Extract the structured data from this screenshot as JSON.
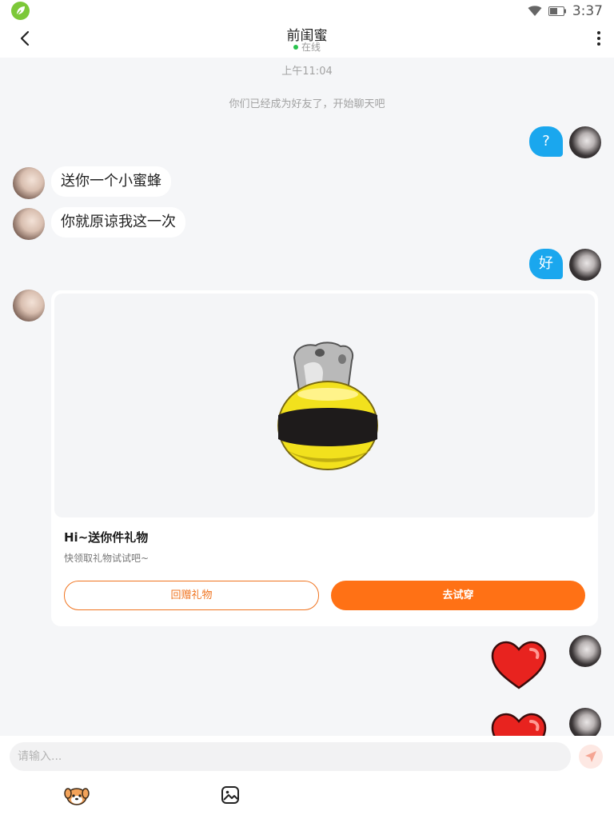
{
  "status_bar": {
    "time": "3:37",
    "icons": [
      "app-logo-icon",
      "wifi-icon",
      "battery-icon"
    ]
  },
  "header": {
    "title": "前闺蜜",
    "status": "在线",
    "icons": [
      "back-icon",
      "more-icon"
    ]
  },
  "timestamp": "上午11:04",
  "system_message": "你们已经成为好友了，开始聊天吧",
  "messages": [
    {
      "from": "me",
      "type": "text",
      "text": "?"
    },
    {
      "from": "other",
      "type": "text",
      "text": "送你一个小蜜蜂"
    },
    {
      "from": "other",
      "type": "text",
      "text": "你就原谅我这一次"
    },
    {
      "from": "me",
      "type": "text",
      "text": "好"
    },
    {
      "from": "other",
      "type": "gift_card",
      "title": "Hi~送你件礼物",
      "subtitle": "快领取礼物试试吧~",
      "return_gift_label": "回赠礼物",
      "try_on_label": "去试穿"
    },
    {
      "from": "me",
      "type": "sticker",
      "sticker": "heart-icon"
    },
    {
      "from": "me",
      "type": "sticker",
      "sticker": "heart-icon"
    }
  ],
  "composer": {
    "placeholder": "请输入...",
    "icons": [
      "send-icon",
      "pet-icon",
      "image-icon"
    ]
  },
  "colors": {
    "accent": "#ff7115",
    "bubble_out": "#1aa7ee",
    "online_dot": "#29c24d"
  }
}
